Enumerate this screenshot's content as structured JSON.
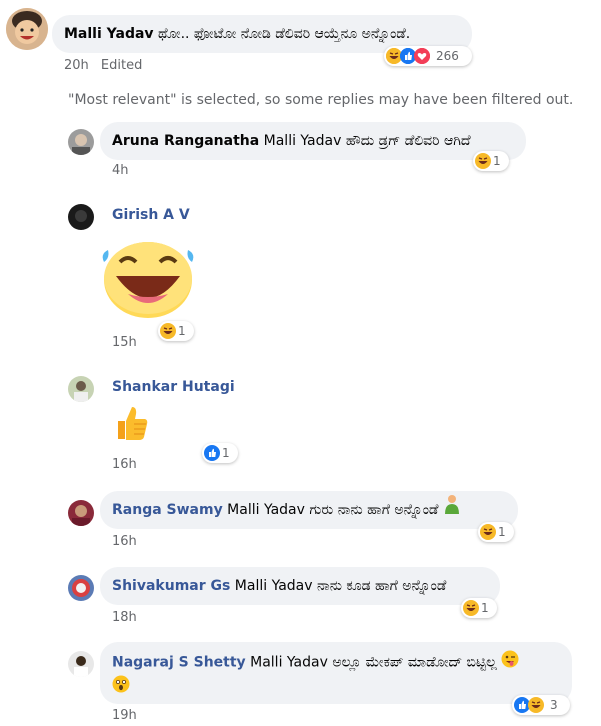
{
  "comments": [
    {
      "author": "Malli Yadav",
      "text": "ಥೋ.. ಫೋಟೋ ನೋಡಿ ಡೆಲಿವರಿ ಆಯ್ತೆನೂ ಅನ್ನೊಂಡೆ.",
      "time": "20h",
      "edited": "Edited",
      "reaction_count": "266"
    },
    {
      "author": "Aruna Ranganatha",
      "mention": "Malli Yadav",
      "text": "ಹೌದು ಡ್ರಗ್ ಡೆಲಿವರಿ ಆಗಿದೆ",
      "time": "4h",
      "reaction_count": "1"
    },
    {
      "author": "Girish A V",
      "time": "15h",
      "reaction_count": "1"
    },
    {
      "author": "Shankar Hutagi",
      "time": "16h",
      "reaction_count": "1"
    },
    {
      "author": "Ranga Swamy",
      "mention": "Malli Yadav",
      "text": "ಗುರು ನಾನು ಹಾಗೆ ಅನ್ನೊಂಡೆ",
      "time": "16h",
      "reaction_count": "1"
    },
    {
      "author": "Shivakumar Gs",
      "mention": "Malli Yadav",
      "text": "ನಾನು ಕೂಡ ಹಾಗೆ ಅನ್ನೊಂಡೆ",
      "time": "18h",
      "reaction_count": "1"
    },
    {
      "author": "Nagaraj S Shetty",
      "mention": "Malli Yadav",
      "text": "ಅಲ್ಲೂ ಮೇಕಪ್ ಮಾಡೋದ್ ಬಿಟ್ಟಿಲ್ಲ",
      "time": "19h",
      "reaction_count": "3"
    }
  ],
  "filter_notice": "\"Most relevant\" is selected, so some replies may have been filtered out.",
  "icons": [
    "haha-reaction-icon",
    "like-reaction-icon",
    "love-reaction-icon",
    "laughing-tears-sticker",
    "thumbs-up-emoji",
    "man-emoji",
    "winking-tongue-emoji",
    "astonished-emoji"
  ],
  "colors": {
    "author_blue": "#385898",
    "bubble_bg": "#f0f2f5",
    "meta_gray": "#65676b",
    "like_blue": "#1877f2",
    "love_red": "#f33e58",
    "haha_yellow": "#f7b928"
  }
}
